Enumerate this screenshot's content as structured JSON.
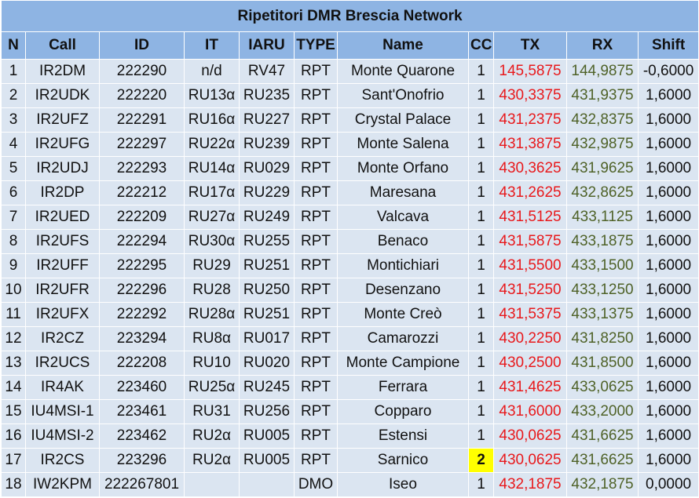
{
  "title": "Ripetitori DMR Brescia Network",
  "headers": [
    "N",
    "Call",
    "ID",
    "IT",
    "IARU",
    "TYPE",
    "Name",
    "CC",
    "TX",
    "RX",
    "Shift"
  ],
  "colors": {
    "header_bg": "#8eb4e3",
    "row_bg": "#dbe5f1",
    "tx": "#e8191c",
    "rx": "#4f6228",
    "highlight": "#ffff00"
  },
  "rows": [
    {
      "n": "1",
      "call": "IR2DM",
      "id": "222290",
      "it": "n/d",
      "iaru": "RV47",
      "type": "RPT",
      "name": "Monte Quarone",
      "cc": "1",
      "tx": "145,5875",
      "rx": "144,9875",
      "shift": "-0,6000"
    },
    {
      "n": "2",
      "call": "IR2UDK",
      "id": "222220",
      "it": "RU13α",
      "iaru": "RU235",
      "type": "RPT",
      "name": "Sant'Onofrio",
      "cc": "1",
      "tx": "430,3375",
      "rx": "431,9375",
      "shift": "1,6000"
    },
    {
      "n": "3",
      "call": "IR2UFZ",
      "id": "222291",
      "it": "RU16α",
      "iaru": "RU227",
      "type": "RPT",
      "name": "Crystal Palace",
      "cc": "1",
      "tx": "431,2375",
      "rx": "432,8375",
      "shift": "1,6000"
    },
    {
      "n": "4",
      "call": "IR2UFG",
      "id": "222297",
      "it": "RU22α",
      "iaru": "RU239",
      "type": "RPT",
      "name": "Monte Salena",
      "cc": "1",
      "tx": "431,3875",
      "rx": "432,9875",
      "shift": "1,6000"
    },
    {
      "n": "5",
      "call": "IR2UDJ",
      "id": "222293",
      "it": "RU14α",
      "iaru": "RU029",
      "type": "RPT",
      "name": "Monte Orfano",
      "cc": "1",
      "tx": "430,3625",
      "rx": "431,9625",
      "shift": "1,6000"
    },
    {
      "n": "6",
      "call": "IR2DP",
      "id": "222212",
      "it": "RU17α",
      "iaru": "RU229",
      "type": "RPT",
      "name": "Maresana",
      "cc": "1",
      "tx": "431,2625",
      "rx": "432,8625",
      "shift": "1,6000"
    },
    {
      "n": "7",
      "call": "IR2UED",
      "id": "222209",
      "it": "RU27α",
      "iaru": "RU249",
      "type": "RPT",
      "name": "Valcava",
      "cc": "1",
      "tx": "431,5125",
      "rx": "433,1125",
      "shift": "1,6000"
    },
    {
      "n": "8",
      "call": "IR2UFS",
      "id": "222294",
      "it": "RU30α",
      "iaru": "RU255",
      "type": "RPT",
      "name": "Benaco",
      "cc": "1",
      "tx": "431,5875",
      "rx": "433,1875",
      "shift": "1,6000"
    },
    {
      "n": "9",
      "call": "IR2UFF",
      "id": "222295",
      "it": "RU29",
      "iaru": "RU251",
      "type": "RPT",
      "name": "Montichiari",
      "cc": "1",
      "tx": "431,5500",
      "rx": "433,1500",
      "shift": "1,6000"
    },
    {
      "n": "10",
      "call": "IR2UFR",
      "id": "222296",
      "it": "RU28",
      "iaru": "RU250",
      "type": "RPT",
      "name": "Desenzano",
      "cc": "1",
      "tx": "431,5250",
      "rx": "433,1250",
      "shift": "1,6000"
    },
    {
      "n": "11",
      "call": "IR2UFX",
      "id": "222292",
      "it": "RU28α",
      "iaru": "RU251",
      "type": "RPT",
      "name": "Monte Creò",
      "cc": "1",
      "tx": "431,5375",
      "rx": "433,1375",
      "shift": "1,6000"
    },
    {
      "n": "12",
      "call": "IR2CZ",
      "id": "223294",
      "it": "RU8α",
      "iaru": "RU017",
      "type": "RPT",
      "name": "Camarozzi",
      "cc": "1",
      "tx": "430,2250",
      "rx": "431,8250",
      "shift": "1,6000"
    },
    {
      "n": "13",
      "call": "IR2UCS",
      "id": "222208",
      "it": "RU10",
      "iaru": "RU020",
      "type": "RPT",
      "name": "Monte Campione",
      "cc": "1",
      "tx": "430,2500",
      "rx": "431,8500",
      "shift": "1,6000"
    },
    {
      "n": "14",
      "call": "IR4AK",
      "id": "223460",
      "it": "RU25α",
      "iaru": "RU245",
      "type": "RPT",
      "name": "Ferrara",
      "cc": "1",
      "tx": "431,4625",
      "rx": "433,0625",
      "shift": "1,6000"
    },
    {
      "n": "15",
      "call": "IU4MSI-1",
      "id": "223461",
      "it": "RU31",
      "iaru": "RU256",
      "type": "RPT",
      "name": "Copparo",
      "cc": "1",
      "tx": "431,6000",
      "rx": "433,2000",
      "shift": "1,6000"
    },
    {
      "n": "16",
      "call": "IU4MSI-2",
      "id": "223462",
      "it": "RU2α",
      "iaru": "RU005",
      "type": "RPT",
      "name": "Estensi",
      "cc": "1",
      "tx": "430,0625",
      "rx": "431,6625",
      "shift": "1,6000"
    },
    {
      "n": "17",
      "call": "IR2CS",
      "id": "223296",
      "it": "RU2α",
      "iaru": "RU005",
      "type": "RPT",
      "name": "Sarnico",
      "cc": "2",
      "tx": "430,0625",
      "rx": "431,6625",
      "shift": "1,6000",
      "cc_highlight": true
    },
    {
      "n": "18",
      "call": "IW2KPM",
      "id": "222267801",
      "it": "",
      "iaru": "",
      "type": "DMO",
      "name": "Iseo",
      "cc": "1",
      "tx": "432,1875",
      "rx": "432,1875",
      "shift": "0,0000"
    }
  ]
}
